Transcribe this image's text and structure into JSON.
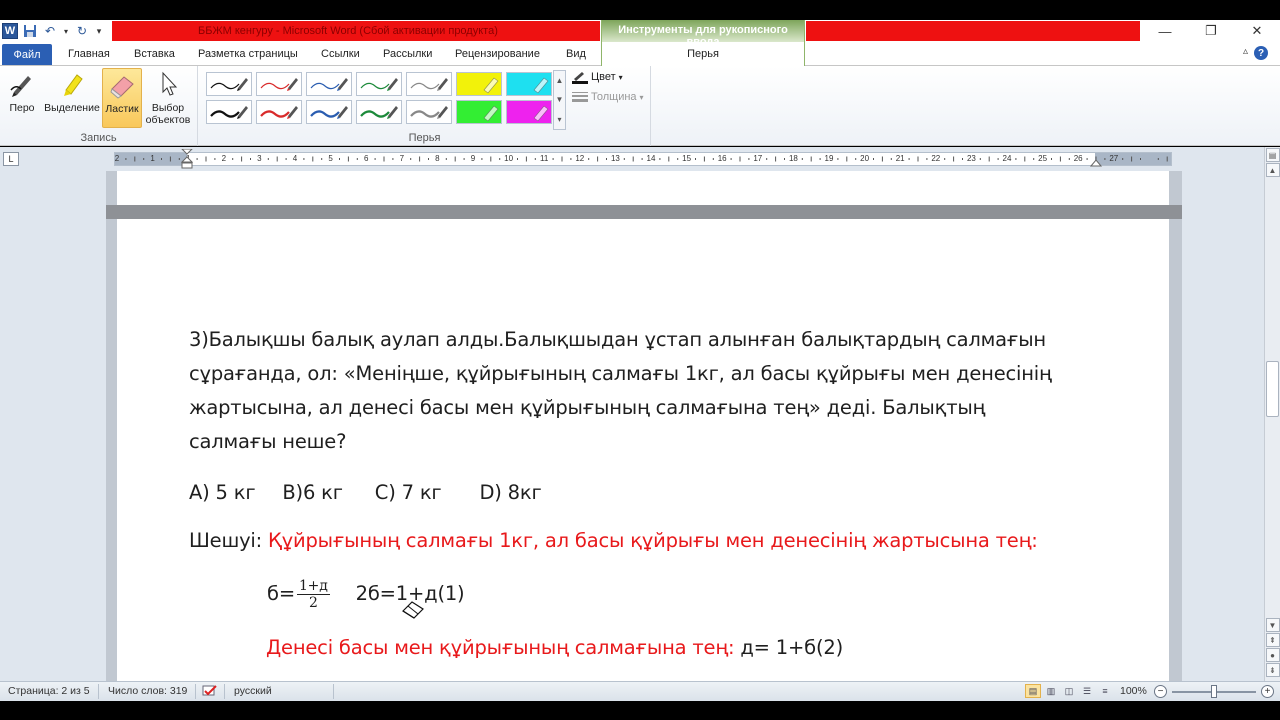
{
  "app": {
    "window_title": "ББЖМ кенгуру  -  Microsoft Word (Сбой активации продукта)",
    "contextual_tab_group": "Инструменты для рукописного ввода"
  },
  "tabs": {
    "file": "Файл",
    "items": [
      "Главная",
      "Вставка",
      "Разметка страницы",
      "Ссылки",
      "Рассылки",
      "Рецензирование",
      "Вид"
    ],
    "contextual": "Перья"
  },
  "ribbon": {
    "record_group": {
      "label": "Запись",
      "buttons": [
        "Перо",
        "Выделение",
        "Ластик",
        "Выбор объектов"
      ]
    },
    "pens_group": {
      "label": "Перья",
      "color_label": "Цвет",
      "thickness_label": "Толщина",
      "pen_colors": [
        "#111111",
        "#d92b2b",
        "#2a5db0",
        "#1c8a3a",
        "#888888",
        "#f2f20a",
        "#1ee0f0",
        "#111111",
        "#d92b2b",
        "#2a5db0",
        "#1c8a3a",
        "#888888",
        "#33ee33",
        "#ee22ee"
      ]
    }
  },
  "ruler": {
    "numbers": [
      "2",
      "1",
      "1",
      "2",
      "3",
      "4",
      "5",
      "6",
      "7",
      "8",
      "9",
      "10",
      "11",
      "12",
      "13",
      "14",
      "15",
      "16",
      "17",
      "18",
      "19",
      "20",
      "21",
      "22",
      "23",
      "24",
      "25",
      "26",
      "27"
    ]
  },
  "document": {
    "problem_lines": [
      "3)Балықшы балық аулап алды.Балықшыдан ұстап алынған балықтардың салмағын",
      "сұрағанда, ол: «Меніңше, құйрығының салмағы 1кг, ал басы құйрығы мен денесінің",
      "жартысына, ал денесі   басы мен құйрығының салмағына тең» деді. Балықтың",
      "салмағы неше?"
    ],
    "options": [
      "А) 5 кг",
      "В)6 кг",
      "С) 7 кг",
      "D) 8кг"
    ],
    "solution_label": "Шешуі: ",
    "solution_text": "Құйрығының салмағы 1кг, ал басы құйрығы мен денесінің жартысына тең:",
    "eq1_lhs": "б=",
    "eq1_num": "1+д",
    "eq1_den": "2",
    "eq1_rhs": "2б=1+д(1)",
    "eq2_red": "Денесі   басы мен құйрығының салмағына тең: ",
    "eq2_black": "д= 1+б(2)"
  },
  "statusbar": {
    "page": "Страница: 2 из 5",
    "words": "Число слов: 319",
    "language": "русский",
    "zoom": "100%",
    "zoom_fraction": 0.5
  }
}
